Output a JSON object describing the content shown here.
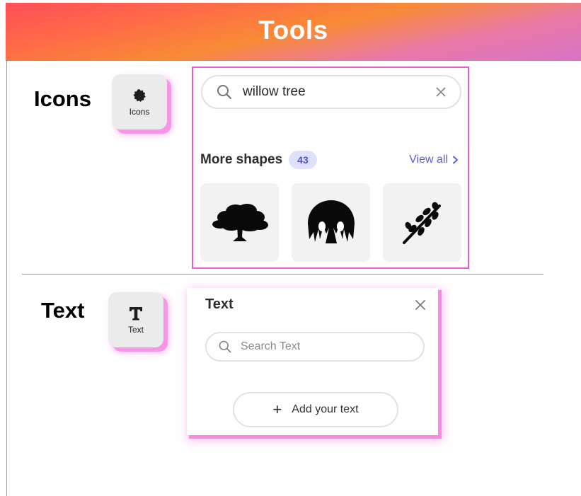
{
  "header": {
    "title": "Tools"
  },
  "sections": {
    "icons": {
      "label": "Icons",
      "tile_label": "Icons"
    },
    "text": {
      "label": "Text",
      "tile_label": "Text"
    }
  },
  "icons_panel": {
    "search": {
      "value": "willow tree",
      "search_icon": "search-icon",
      "clear_icon": "close-icon"
    },
    "more_shapes": {
      "title": "More shapes",
      "count": "43",
      "view_all": "View all"
    },
    "shapes": [
      {
        "name": "oak-tree-icon"
      },
      {
        "name": "willow-tree-icon"
      },
      {
        "name": "willow-branch-icon"
      }
    ]
  },
  "text_panel": {
    "title": "Text",
    "search_placeholder": "Search Text",
    "add_button": "Add your text"
  },
  "colors": {
    "accent_pink": "#e65fcf",
    "link_blue": "#5a5ed8",
    "badge_bg": "#dfe0fb"
  }
}
